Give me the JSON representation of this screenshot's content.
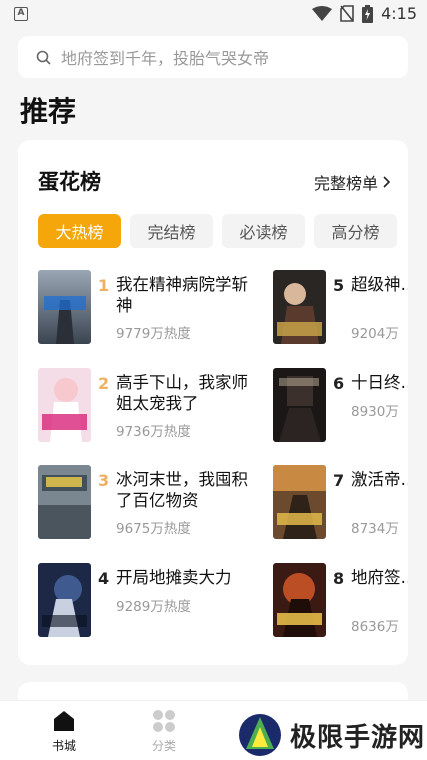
{
  "status_bar": {
    "time": "4:15"
  },
  "search": {
    "placeholder": "地府签到千年，投胎气哭女帝"
  },
  "section_title": "推荐",
  "ranking_card": {
    "title": "蛋花榜",
    "full_list_link": "完整榜单",
    "tabs": [
      "大热榜",
      "完结榜",
      "必读榜",
      "高分榜"
    ],
    "active_tab": "大热榜",
    "books": [
      {
        "rank": "1",
        "name": "我在精神病院学斩神",
        "heat": "9779万热度",
        "rank_color": "#f0b062",
        "cover_text": "精神病院学斩神"
      },
      {
        "rank": "2",
        "name": "高手下山，我家师姐太宠我了",
        "heat": "9736万热度",
        "rank_color": "#f0b062",
        "cover_text": "我家师姐太宠我了"
      },
      {
        "rank": "3",
        "name": "冰河末世，我囤积了百亿物资",
        "heat": "9675万热度",
        "rank_color": "#f0b062",
        "cover_text": "我囤积了百亿物资"
      },
      {
        "rank": "4",
        "name": "开局地摊卖大力",
        "heat": "9289万热度",
        "rank_color": "#222222",
        "cover_text": "卖大力"
      },
      {
        "rank": "5",
        "name": "超级神…倍返现",
        "heat": "9204万",
        "rank_color": "#222222",
        "cover_text": "开局十倍返现"
      },
      {
        "rank": "6",
        "name": "十日终…",
        "heat": "8930万",
        "rank_color": "#222222",
        "cover_text": "十日终焉"
      },
      {
        "rank": "7",
        "name": "激活帝…局召唤",
        "heat": "8734万",
        "rank_color": "#222222",
        "cover_text": "开局召唤"
      },
      {
        "rank": "8",
        "name": "地府签…胎气哭",
        "heat": "8636万",
        "rank_color": "#222222",
        "cover_text": "签到千年"
      }
    ]
  },
  "bottom_nav": {
    "items": [
      {
        "label": "书城",
        "active": true
      },
      {
        "label": "分类",
        "active": false
      }
    ]
  },
  "watermark": {
    "text": "极限手游网"
  }
}
